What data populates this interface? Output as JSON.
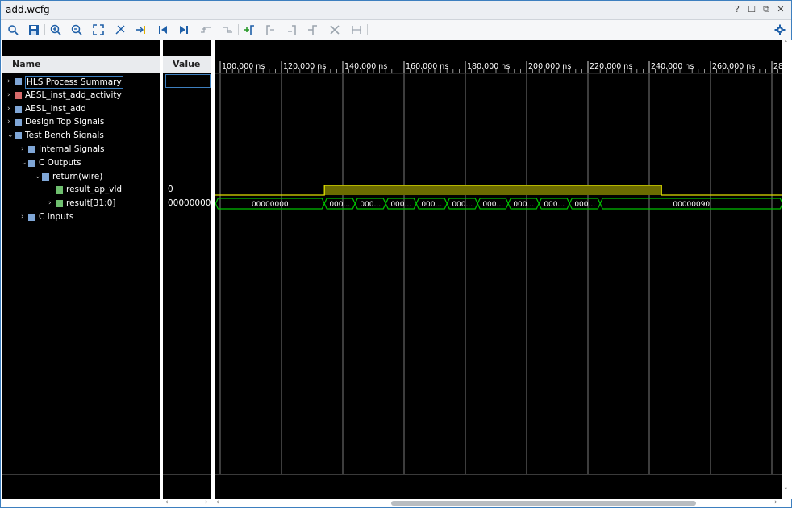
{
  "window": {
    "title": "add.wcfg",
    "controls": [
      "?",
      "☐",
      "⧉",
      "✕"
    ]
  },
  "toolbar": {
    "icons": [
      "search-icon",
      "save-icon",
      "zoom-in-icon",
      "zoom-out-icon",
      "zoom-fit-icon",
      "cursor-snap-icon",
      "go-to-cursor-icon",
      "go-to-start-icon",
      "go-to-end-icon",
      "previous-transition-icon",
      "next-transition-icon",
      "add-marker-icon",
      "previous-marker-icon",
      "next-marker-icon",
      "swap-cursors-icon",
      "delete-marker-icon",
      "marker-span-icon",
      "settings-icon"
    ]
  },
  "columns": {
    "name": "Name",
    "value": "Value"
  },
  "rows": [
    {
      "label": "HLS Process Summary",
      "value": "",
      "expand": "›",
      "icon_color": "#7fa6d6"
    },
    {
      "label": "AESL_inst_add_activity",
      "value": "",
      "expand": "›",
      "icon_color": "#d66a6a"
    },
    {
      "label": "AESL_inst_add",
      "value": "",
      "expand": "›",
      "icon_color": "#7fa6d6"
    },
    {
      "label": "Design Top Signals",
      "value": "",
      "expand": "›",
      "icon_color": "#7fa6d6"
    },
    {
      "label": "Test Bench Signals",
      "value": "",
      "expand": "⌄",
      "icon_color": "#7fa6d6"
    },
    {
      "label": "Internal Signals",
      "value": "",
      "expand": "›",
      "icon_color": "#7fa6d6"
    },
    {
      "label": "C Outputs",
      "value": "",
      "expand": "⌄",
      "icon_color": "#7fa6d6"
    },
    {
      "label": "return(wire)",
      "value": "",
      "expand": "⌄",
      "icon_color": "#7fa6d6"
    },
    {
      "label": "result_ap_vld",
      "value": "0",
      "expand": "",
      "icon_color": "#6fbf6f"
    },
    {
      "label": "result[31:0]",
      "value": "00000000",
      "expand": "›",
      "icon_color": "#6fbf6f"
    },
    {
      "label": "C Inputs",
      "value": "",
      "expand": "›",
      "icon_color": "#7fa6d6"
    }
  ],
  "timeline": {
    "ticks": [
      "100.000 ns",
      "120.000 ns",
      "140.000 ns",
      "160.000 ns",
      "180.000 ns",
      "200.000 ns",
      "220.000 ns",
      "240.000 ns",
      "260.000 ns",
      "28"
    ],
    "range_ns": [
      98.5,
      283.5
    ],
    "valid_pulse_ns": [
      134,
      244
    ]
  },
  "bus": {
    "segments": [
      {
        "start": 98.5,
        "end": 134,
        "label": "00000000"
      },
      {
        "start": 134,
        "end": 144,
        "label": "000..."
      },
      {
        "start": 144,
        "end": 154,
        "label": "000..."
      },
      {
        "start": 154,
        "end": 164,
        "label": "000..."
      },
      {
        "start": 164,
        "end": 174,
        "label": "000..."
      },
      {
        "start": 174,
        "end": 184,
        "label": "000..."
      },
      {
        "start": 184,
        "end": 194,
        "label": "000..."
      },
      {
        "start": 194,
        "end": 204,
        "label": "000..."
      },
      {
        "start": 204,
        "end": 214,
        "label": "000..."
      },
      {
        "start": 214,
        "end": 224,
        "label": "000..."
      },
      {
        "start": 224,
        "end": 283.5,
        "label": "00000090"
      }
    ]
  },
  "colors": {
    "grid": "#7a7a7a",
    "bit": "#e0e000",
    "bit_fill": "#6b6b00",
    "bus": "#00c000",
    "text": "#ffffff"
  }
}
